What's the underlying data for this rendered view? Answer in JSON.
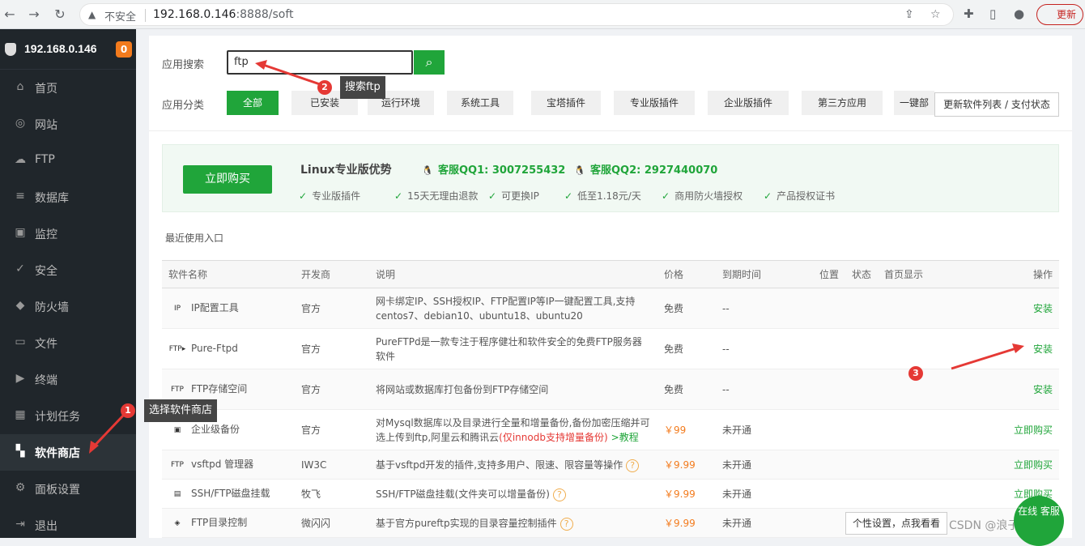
{
  "browser": {
    "back": "←",
    "forward": "→",
    "reload": "↻",
    "insecure": "不安全",
    "url_host": "192.168.0.146",
    "url_rest": ":8888/soft",
    "refresh_label": "更新"
  },
  "sidebar": {
    "ip": "192.168.0.146",
    "badge": "0",
    "items": [
      {
        "label": "首页",
        "icon": "⌂"
      },
      {
        "label": "网站",
        "icon": "◎"
      },
      {
        "label": "FTP",
        "icon": "☁"
      },
      {
        "label": "数据库",
        "icon": "≡"
      },
      {
        "label": "监控",
        "icon": "▣"
      },
      {
        "label": "安全",
        "icon": "✓"
      },
      {
        "label": "防火墙",
        "icon": "◆"
      },
      {
        "label": "文件",
        "icon": "▭"
      },
      {
        "label": "终端",
        "icon": "▶"
      },
      {
        "label": "计划任务",
        "icon": "▦"
      },
      {
        "label": "软件商店",
        "icon": "▚"
      },
      {
        "label": "面板设置",
        "icon": "⚙"
      },
      {
        "label": "退出",
        "icon": "⇥"
      }
    ]
  },
  "search": {
    "label": "应用搜索",
    "value": "ftp"
  },
  "categories": {
    "label": "应用分类",
    "items": [
      "全部",
      "已安装",
      "运行环境",
      "系统工具",
      "宝塔插件",
      "专业版插件",
      "企业版插件",
      "第三方应用",
      "一键部"
    ],
    "update_button": "更新软件列表 / 支付状态"
  },
  "promo": {
    "buy": "立即购买",
    "title": "Linux专业版优势",
    "qq1": "客服QQ1: 3007255432",
    "qq2": "客服QQ2: 2927440070",
    "features": [
      "专业版插件",
      "15天无理由退款",
      "可更换IP",
      "低至1.18元/天",
      "商用防火墙授权",
      "产品授权证书"
    ]
  },
  "recent_label": "最近使用入口",
  "table": {
    "headers": [
      "软件名称",
      "开发商",
      "说明",
      "价格",
      "到期时间",
      "位置",
      "状态",
      "首页显示",
      "操作"
    ],
    "rows": [
      {
        "icon": "IP",
        "name": "IP配置工具",
        "dev": "官方",
        "desc": "网卡绑定IP、SSH授权IP、FTP配置IP等IP一键配置工具,支持centos7、debian10、ubuntu18、ubuntu20",
        "price": "免费",
        "expire": "--",
        "action": "安装"
      },
      {
        "icon": "FTP▸",
        "name": "Pure-Ftpd",
        "dev": "官方",
        "desc": "PureFTPd是一款专注于程序健壮和软件安全的免费FTP服务器软件",
        "price": "免费",
        "expire": "--",
        "action": "安装"
      },
      {
        "icon": "FTP",
        "name": "FTP存储空间",
        "dev": "官方",
        "desc": "将网站或数据库打包备份到FTP存储空间",
        "price": "免费",
        "expire": "--",
        "action": "安装"
      },
      {
        "icon": "▣",
        "name": "企业级备份",
        "dev": "官方",
        "desc": "对Mysql数据库以及目录进行全量和增量备份,备份加密压缩并可选上传到ftp,阿里云和腾讯云",
        "desc_red": "(仅innodb支持增量备份)",
        "desc_link": ">教程",
        "price": "￥99",
        "expire": "未开通",
        "action": "立即购买"
      },
      {
        "icon": "FTP",
        "name": "vsftpd 管理器",
        "dev": "IW3C",
        "desc": "基于vsftpd开发的插件,支持多用户、限速、限容量等操作",
        "price": "￥9.99",
        "expire": "未开通",
        "action": "立即购买"
      },
      {
        "icon": "▤",
        "name": "SSH/FTP磁盘挂载",
        "dev": "牧飞",
        "desc": "SSH/FTP磁盘挂载(文件夹可以增量备份)",
        "price": "￥9.99",
        "expire": "未开通",
        "action": "立即购买"
      },
      {
        "icon": "◈",
        "name": "FTP目录控制",
        "dev": "微闪闪",
        "desc": "基于官方pureftp实现的目录容量控制插件",
        "price": "￥9.99",
        "expire": "未开通",
        "action": "立即购买"
      }
    ]
  },
  "annotations": {
    "n1": "1",
    "t1": "选择软件商店",
    "n2": "2",
    "t2": "搜索ftp",
    "n3": "3"
  },
  "footer": {
    "csdn": "CSDN @浪子晨天",
    "online": "在线 客服",
    "personal": "个性设置，点我看看"
  }
}
